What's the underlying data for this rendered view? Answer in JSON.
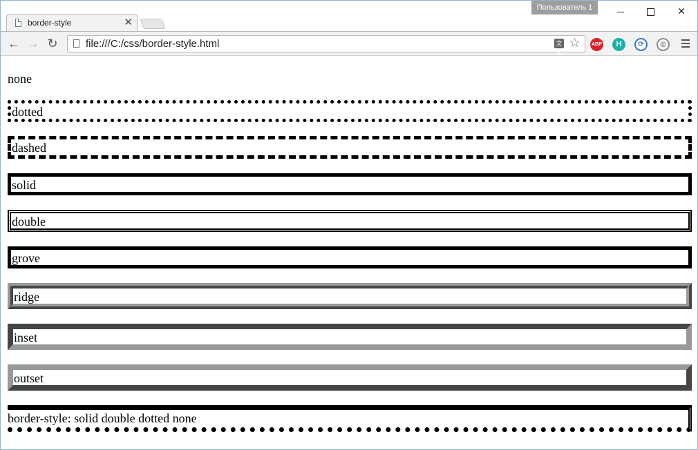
{
  "browser": {
    "tab_title": "border-style",
    "tab_close": "✕",
    "user_badge": "Пользователь 1",
    "url": "file:///C:/css/border-style.html",
    "back": "←",
    "forward": "→",
    "reload": "↻",
    "star": "☆",
    "translate_icon": "文A",
    "extensions": {
      "abp": "ABP",
      "h": "H",
      "sync": "⟳",
      "compass": "◎"
    },
    "close_glyph": "✕"
  },
  "page": {
    "boxes": [
      {
        "style": "none",
        "label": "none"
      },
      {
        "style": "dotted",
        "label": "dotted"
      },
      {
        "style": "dashed",
        "label": "dashed"
      },
      {
        "style": "solid",
        "label": "solid"
      },
      {
        "style": "double",
        "label": "double"
      },
      {
        "style": "grove",
        "label": "grove"
      },
      {
        "style": "ridge",
        "label": "ridge"
      },
      {
        "style": "inset",
        "label": "inset"
      },
      {
        "style": "outset",
        "label": "outset"
      },
      {
        "style": "mixed",
        "label": "border-style: solid double dotted none"
      }
    ]
  }
}
